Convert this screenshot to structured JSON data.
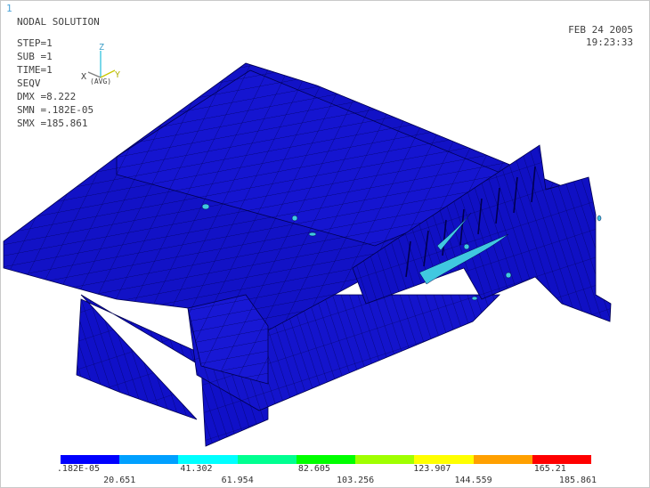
{
  "viewport_index": "1",
  "title": "NODAL SOLUTION",
  "stats": [
    "STEP=1",
    "SUB =1",
    "TIME=1",
    "SEQV",
    "DMX =8.222",
    "SMN =.182E-05",
    "SMX =185.861"
  ],
  "date": "FEB 24 2005",
  "time": "19:23:33",
  "triad": {
    "z": "Z",
    "y": "Y",
    "x": "X",
    "avg": "(AVG)"
  },
  "legend": {
    "colors": [
      "#0000ff",
      "#00a0ff",
      "#00ffff",
      "#00ff90",
      "#00ff00",
      "#a0ff00",
      "#ffff00",
      "#ffa000",
      "#ff0000"
    ],
    "top_labels": [
      ".182E-05",
      "41.302",
      "82.605",
      "123.907",
      "165.21"
    ],
    "bottom_labels": [
      "20.651",
      "61.954",
      "103.256",
      "144.559",
      "185.861"
    ]
  },
  "model": {
    "fill": "#1010c8",
    "edge": "#000050",
    "hot_spot": "#40c8e0"
  }
}
